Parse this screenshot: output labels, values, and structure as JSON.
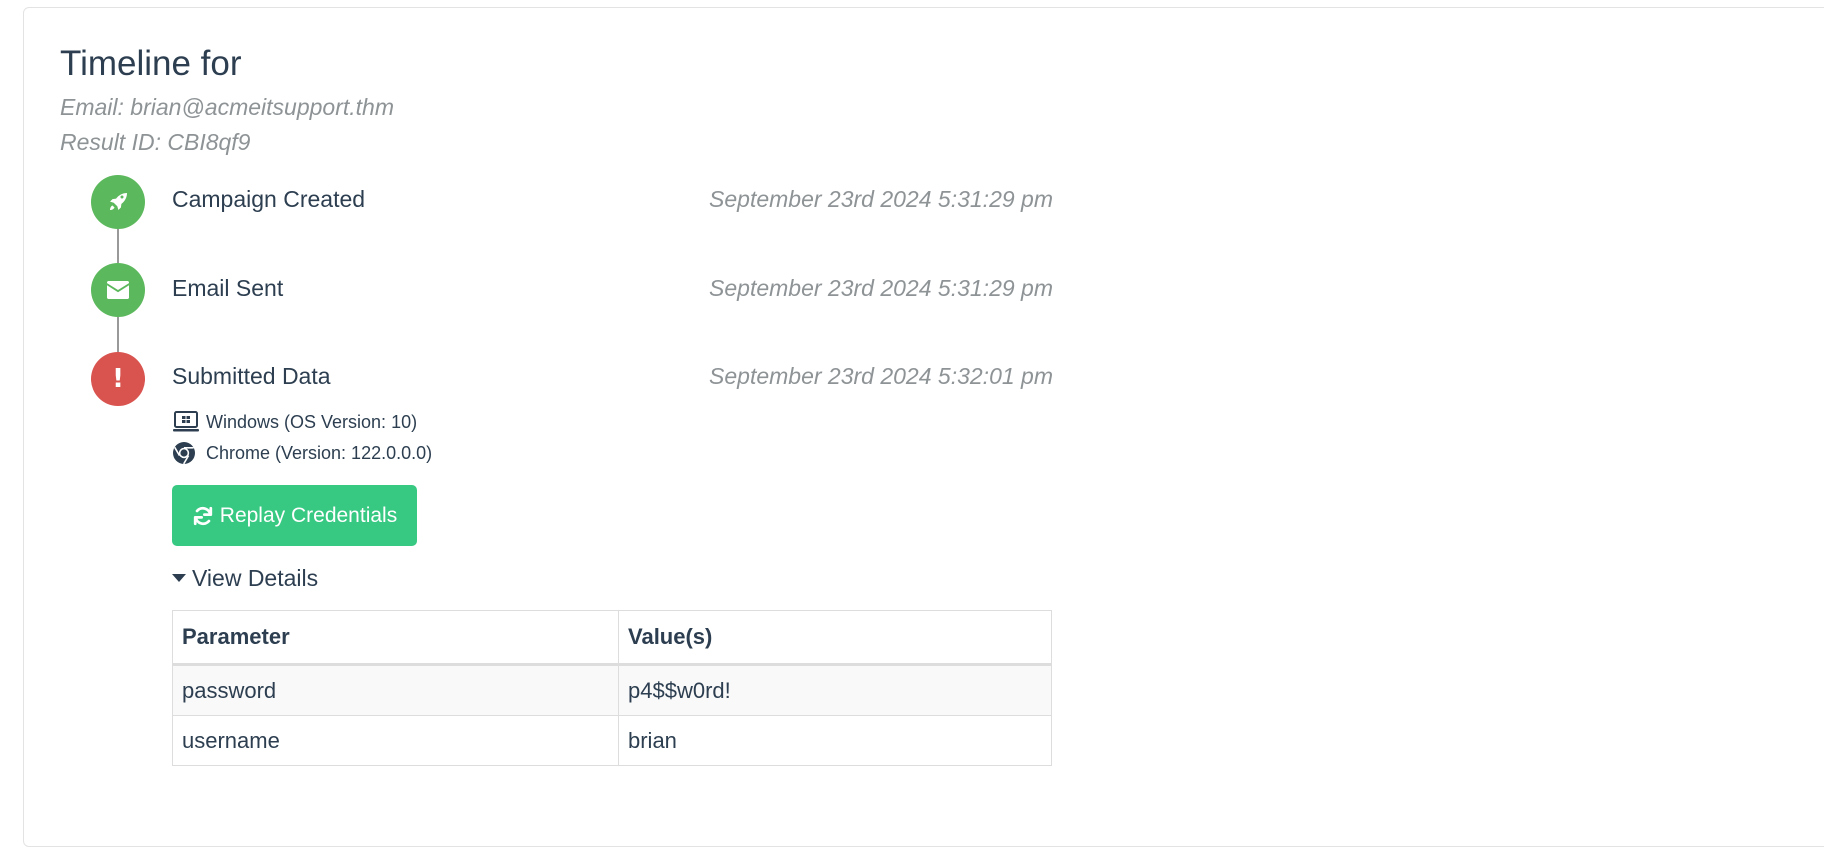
{
  "header": {
    "title": "Timeline for",
    "email_line": "Email: brian@acmeitsupport.thm",
    "result_line": "Result ID: CBI8qf9"
  },
  "timeline": [
    {
      "label": "Campaign Created",
      "time": "September 23rd 2024 5:31:29 pm",
      "icon": "rocket-icon",
      "color": "#5cb85c"
    },
    {
      "label": "Email Sent",
      "time": "September 23rd 2024 5:31:29 pm",
      "icon": "envelope-icon",
      "color": "#5cb85c"
    },
    {
      "label": "Submitted Data",
      "time": "September 23rd 2024 5:32:01 pm",
      "icon": "exclamation-icon",
      "color": "#d9534f"
    }
  ],
  "environment": {
    "os": "Windows (OS Version: 10)",
    "browser": "Chrome (Version: 122.0.0.0)"
  },
  "actions": {
    "replay_label": "Replay Credentials",
    "view_details_label": "View Details"
  },
  "details_table": {
    "headers": [
      "Parameter",
      "Value(s)"
    ],
    "rows": [
      [
        "password",
        "p4$$w0rd!"
      ],
      [
        "username",
        "brian"
      ]
    ]
  },
  "colors": {
    "success": "#5cb85c",
    "danger": "#d9534f",
    "button": "#37c882",
    "muted_text": "#8e9396",
    "text": "#2c3e50"
  }
}
